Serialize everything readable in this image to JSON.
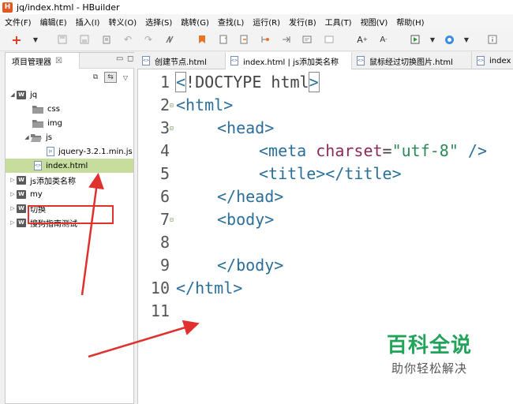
{
  "window": {
    "title": "jq/index.html - HBuilder",
    "app_icon_letter": "H"
  },
  "menu": [
    "文件(F)",
    "编辑(E)",
    "插入(I)",
    "转义(O)",
    "选择(S)",
    "跳转(G)",
    "查找(L)",
    "运行(R)",
    "发行(B)",
    "工具(T)",
    "视图(V)",
    "帮助(H)"
  ],
  "left_panel": {
    "tab_label": "项目管理器",
    "tree": [
      {
        "label": "jq",
        "kind": "project",
        "expanded": true
      },
      {
        "label": "css",
        "kind": "folder"
      },
      {
        "label": "img",
        "kind": "folder"
      },
      {
        "label": "js",
        "kind": "folder",
        "expanded": true
      },
      {
        "label": "jquery-3.2.1.min.js",
        "kind": "file"
      },
      {
        "label": "index.html",
        "kind": "file",
        "selected": true
      },
      {
        "label": "js添加类名称",
        "kind": "project"
      },
      {
        "label": "my",
        "kind": "project"
      },
      {
        "label": "切换",
        "kind": "project"
      },
      {
        "label": "搜狗指南测试",
        "kind": "project"
      }
    ]
  },
  "editor_tabs": [
    "创建节点.html",
    "index.html | js添加类名称",
    "鼠标经过切换图片.html",
    "index"
  ],
  "code": {
    "line_numbers": [
      "1",
      "2",
      "3",
      "4",
      "5",
      "6",
      "7",
      "8",
      "9",
      "10",
      "11"
    ],
    "lines": {
      "l1_open": "<",
      "l1_text": "!DOCTYPE html",
      "l1_close": ">",
      "l2": "<html>",
      "l3": "<head>",
      "l4_tag": "<meta ",
      "l4_attr": "charset",
      "l4_eq": "=",
      "l4_str": "\"utf-8\"",
      "l4_end": " />",
      "l5": "<title></title>",
      "l6": "</head>",
      "l7": "<body>",
      "l9": "</body>",
      "l10": "</html>"
    }
  },
  "watermark": {
    "title": "百科全说",
    "subtitle": "助你轻松解决"
  },
  "colors": {
    "selection": "#c6dd9d",
    "highlight_box": "#e0312e",
    "watermark_green": "#22a35a",
    "tag": "#2a6f9a",
    "attribute": "#8b2a5a",
    "string": "#2e8b57"
  }
}
